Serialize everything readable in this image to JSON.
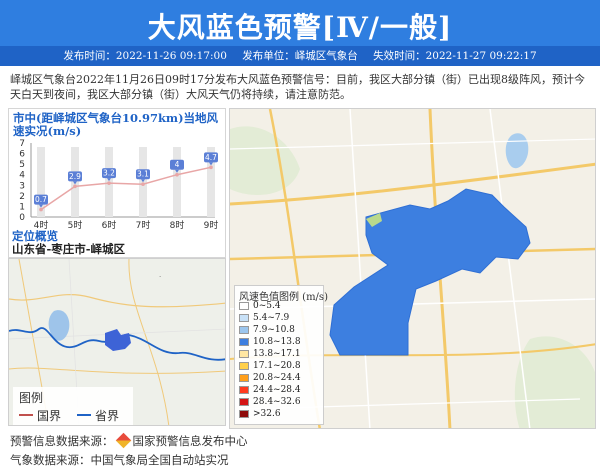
{
  "header": {
    "title": "大风蓝色预警[Ⅳ/一般]",
    "publish_time": "发布时间：2022-11-26 09:17:00",
    "publisher": "发布单位：峄城区气象台",
    "expire_time": "失效时间：2022-11-27 09:22:17"
  },
  "description": "峄城区气象台2022年11月26日09时17分发布大风蓝色预警信号：目前，我区大部分镇（街）已出现8级阵风，预计今天白天到夜间，我区大部分镇（街）大风天气仍将持续，请注意防范。",
  "wind_panel": {
    "title": "市中(距峄城区气象台10.97km)当地风速实况(m/s)"
  },
  "chart_data": {
    "type": "line",
    "categories": [
      "4时",
      "5时",
      "6时",
      "7时",
      "8时",
      "9时"
    ],
    "values": [
      0.7,
      2.9,
      3.2,
      3.1,
      4,
      4.7
    ],
    "value_labels": [
      "0.7",
      "2.9",
      "3.2",
      "3.1",
      "4",
      "4.7"
    ],
    "y_ticks": [
      "0",
      "1",
      "2",
      "3",
      "4",
      "5",
      "6",
      "7"
    ],
    "ylim": [
      0,
      7
    ],
    "grid": false,
    "colors": {
      "line": "#e8a6a6",
      "label_bg": "#5b7fd6"
    }
  },
  "location": {
    "title": "定位概览",
    "value": "山东省-枣庄市-峄城区"
  },
  "minimap_legend": {
    "title": "图例",
    "national": "国界",
    "provincial": "省界",
    "colors": {
      "national": "#c0504d",
      "provincial": "#1f63c6"
    }
  },
  "wind_legend": {
    "title": "风速色值图例 (m/s)",
    "items": [
      {
        "label": "0~5.4",
        "color": "#ffffff"
      },
      {
        "label": "5.4~7.9",
        "color": "#c8e1f7"
      },
      {
        "label": "7.9~10.8",
        "color": "#9cc6ee"
      },
      {
        "label": "10.8~13.8",
        "color": "#3d7fe0"
      },
      {
        "label": "13.8~17.1",
        "color": "#ffe7a3"
      },
      {
        "label": "17.1~20.8",
        "color": "#ffd04a"
      },
      {
        "label": "20.8~24.4",
        "color": "#ff9f1a"
      },
      {
        "label": "24.4~28.4",
        "color": "#ff3b1f"
      },
      {
        "label": "28.4~32.6",
        "color": "#d41414"
      },
      {
        "label": ">32.6",
        "color": "#8e0b0b"
      }
    ]
  },
  "footer": {
    "warning_source": "预警信息数据来源：",
    "warning_source_name": "国家预警信息发布中心",
    "weather_source": "气象数据来源：中国气象局全国自动站实况"
  }
}
